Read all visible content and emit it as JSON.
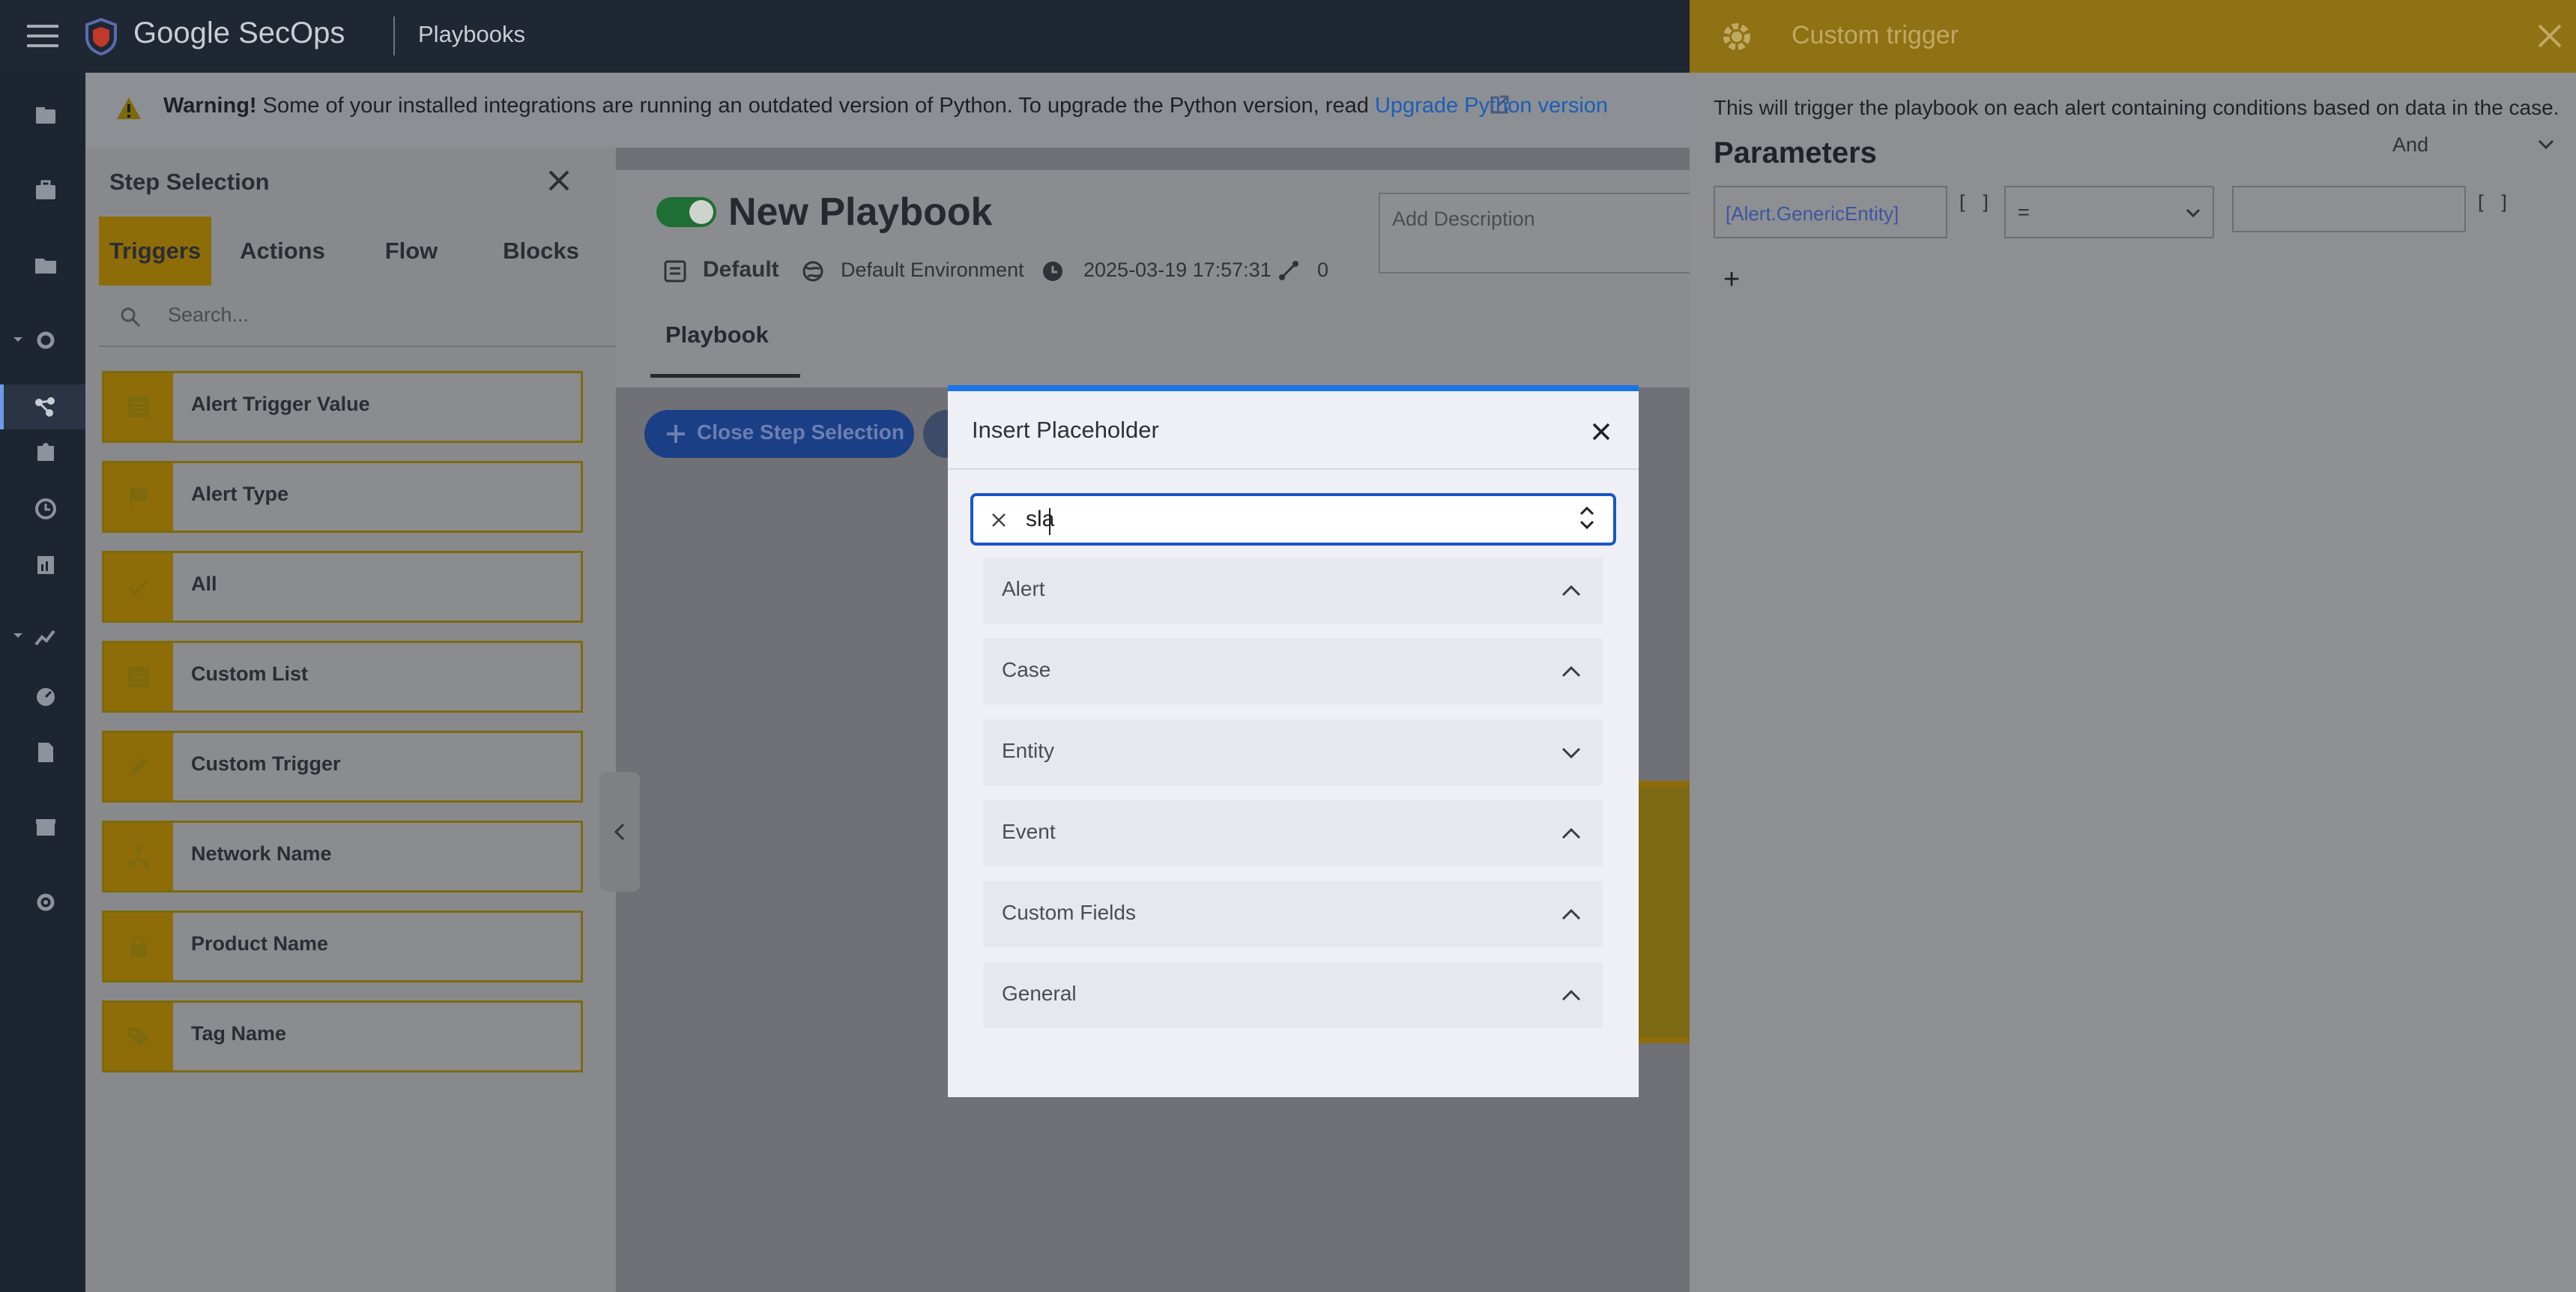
{
  "app": {
    "brand": "Google SecOps",
    "section": "Playbooks"
  },
  "warning": {
    "bold": "Warning!",
    "text": "Some of your installed integrations are running an outdated version of Python. To upgrade the Python version, read",
    "link": "Upgrade Python version"
  },
  "step_selection": {
    "title": "Step Selection",
    "tabs": [
      "Triggers",
      "Actions",
      "Flow",
      "Blocks"
    ],
    "active_tab": "Triggers",
    "search_placeholder": "Search...",
    "items": [
      {
        "label": "Alert Trigger Value",
        "icon": "list-icon"
      },
      {
        "label": "Alert Type",
        "icon": "flag-icon"
      },
      {
        "label": "All",
        "icon": "check-icon"
      },
      {
        "label": "Custom List",
        "icon": "list-icon"
      },
      {
        "label": "Custom Trigger",
        "icon": "pencil-icon"
      },
      {
        "label": "Network Name",
        "icon": "network-icon"
      },
      {
        "label": "Product Name",
        "icon": "lock-icon"
      },
      {
        "label": "Tag Name",
        "icon": "tag-icon"
      }
    ]
  },
  "playbook": {
    "name": "New Playbook",
    "enabled": true,
    "folder": "Default",
    "environment": "Default Environment",
    "modified": "2025-03-19 17:57:31",
    "steps_count": "0",
    "description_placeholder": "Add Description",
    "tab": "Playbook",
    "close_step_button": "Close Step Selection"
  },
  "trigger_panel": {
    "title": "Custom trigger",
    "description": "This will trigger the playbook on each alert containing conditions based on data in the case.",
    "parameters_label": "Parameters",
    "logic": "And",
    "field_value": "[Alert.GenericEntity]",
    "operator": "=",
    "bracket": "[ ]",
    "add_label": "+"
  },
  "modal": {
    "title": "Insert Placeholder",
    "search_value": "sla",
    "sections": [
      {
        "label": "Alert",
        "state": "up"
      },
      {
        "label": "Case",
        "state": "up"
      },
      {
        "label": "Entity",
        "state": "down"
      },
      {
        "label": "Event",
        "state": "up"
      },
      {
        "label": "Custom Fields",
        "state": "up"
      },
      {
        "label": "General",
        "state": "up"
      }
    ]
  },
  "colors": {
    "accent": "#1a73e8",
    "trigger_gold": "#8e6d09",
    "nav_bg": "#1d2530"
  }
}
